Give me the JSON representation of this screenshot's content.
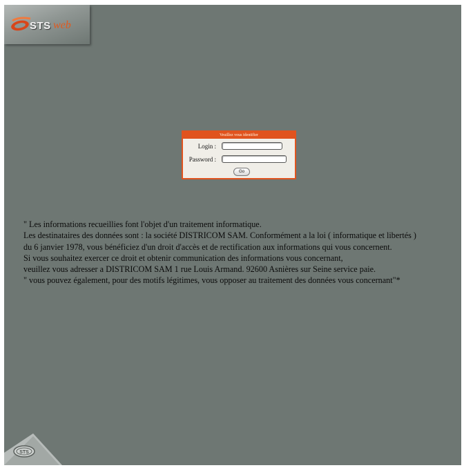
{
  "header": {
    "logo_sts": "STS",
    "logo_web": "web"
  },
  "login": {
    "title": "Veuillez vous identifier",
    "login_label": "Login :",
    "password_label": "Password :",
    "go_label": "Go"
  },
  "notice": {
    "paragraphs": [
      "\" Les informations recueillies font l'objet d'un traitement informatique.",
      "Les destinataires des données sont : la société DISTRICOM SAM. Conformément a la loi ( informatique et libertés )",
      "du 6 janvier 1978, vous bénéficiez d'un droit d'accès et de rectification aux informations qui vous concernent.",
      "Si vous souhaitez exercer ce droit et obtenir communication des informations vous concernant,",
      "veuillez vous adresser a DISTRICOM SAM 1 rue Louis Armand. 92600 Asnières sur Seine service paie.",
      "\" vous pouvez également, pour des motifs légitimes, vous opposer au traitement des données vous concernant\"*"
    ]
  },
  "footer": {
    "logo_text": "STS"
  },
  "colors": {
    "background": "#6e7773",
    "accent": "#e0531e"
  },
  "icons": {
    "header_logo": "sts-web-logo-icon",
    "footer_logo": "sts-badge-icon"
  }
}
